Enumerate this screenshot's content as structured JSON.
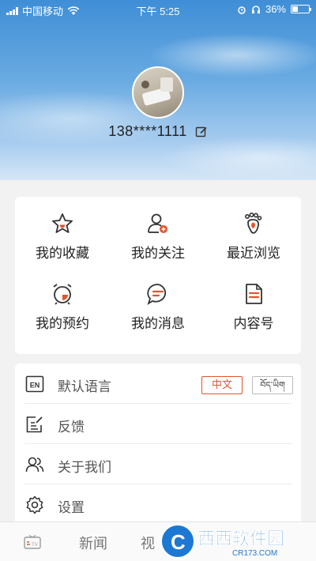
{
  "status_bar": {
    "carrier": "中国移动",
    "time": "下午 5:25",
    "battery": "36%",
    "battery_level": 0.36
  },
  "profile": {
    "phone": "138****1111"
  },
  "grid": {
    "items": [
      {
        "label": "我的收藏",
        "icon": "star-icon"
      },
      {
        "label": "我的关注",
        "icon": "user-add-icon"
      },
      {
        "label": "最近浏览",
        "icon": "footprint-icon"
      },
      {
        "label": "我的预约",
        "icon": "alarm-clock-icon"
      },
      {
        "label": "我的消息",
        "icon": "message-icon"
      },
      {
        "label": "内容号",
        "icon": "document-icon"
      }
    ]
  },
  "list": {
    "language": {
      "label": "默认语言",
      "option_zh": "中文",
      "option_bo": "བོད་ཡིག",
      "selected": "中文"
    },
    "feedback": {
      "label": "反馈"
    },
    "about": {
      "label": "关于我们"
    },
    "settings": {
      "label": "设置"
    }
  },
  "tabbar": {
    "tabs": [
      "新闻",
      "视"
    ]
  },
  "watermark": {
    "logo": "C",
    "main": "西西软件园",
    "sub": "CR173.COM"
  },
  "colors": {
    "accent": "#e0562e",
    "sky": "#3f8ed6"
  }
}
